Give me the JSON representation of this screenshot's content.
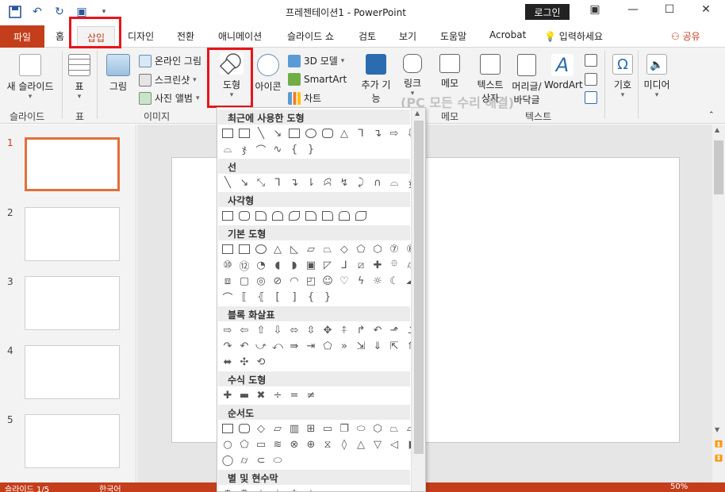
{
  "window": {
    "title": "프레젠테이션1 - PowerPoint",
    "login_label": "로그인"
  },
  "tabs": {
    "file": "파일",
    "home": "홈",
    "insert": "삽입",
    "design": "디자인",
    "transitions": "전환",
    "animations": "애니메이션",
    "slideshow": "슬라이드 쇼",
    "review": "검토",
    "view": "보기",
    "help": "도움말",
    "acrobat": "Acrobat",
    "tellme": "입력하세요",
    "share": "공유"
  },
  "ribbon": {
    "new_slide": "새 슬라이드",
    "table": "표",
    "picture": "그림",
    "online_picture": "온라인 그림",
    "screenshot": "스크린샷",
    "photo_album": "사진 앨범",
    "shapes": "도형",
    "icons": "아이콘",
    "model3d": "3D 모델",
    "smartart": "SmartArt",
    "chart": "차트",
    "addin": "추가 기능",
    "link": "링크",
    "memo": "메모",
    "textbox": "텍스트 상자",
    "header_footer": "머리글/ 바닥글",
    "wordart": "WordArt",
    "symbol": "기호",
    "media": "미디어",
    "groups": {
      "slide": "슬라이드",
      "table": "표",
      "image": "이미지",
      "memo": "메모",
      "text": "텍스트"
    }
  },
  "watermark": {
    "line1": "PC 모든 수리 해결",
    "line2": "(PC 모든 수리 해결)"
  },
  "slides": [
    "1",
    "2",
    "3",
    "4",
    "5"
  ],
  "shapes_menu": {
    "recent": "최근에 사용한 도형",
    "lines": "선",
    "rectangles": "사각형",
    "basic": "기본 도형",
    "block_arrows": "블록 화살표",
    "equation": "수식 도형",
    "flowchart": "순서도",
    "stars": "별 및 현수막"
  },
  "status": {
    "slide_info": "슬라이드 1/5",
    "language": "한국어",
    "zoom": "50%"
  },
  "colors": {
    "accent": "#c43e1c",
    "highlight": "#e8141a",
    "selected_thumb": "#e0703a"
  }
}
